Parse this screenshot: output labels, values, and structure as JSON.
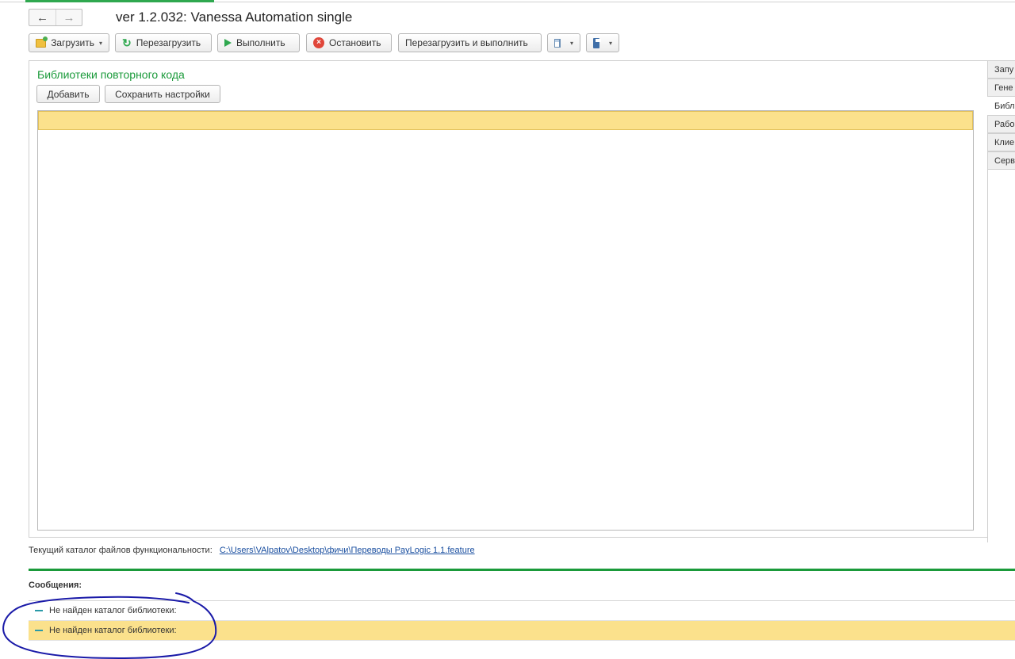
{
  "window": {
    "title": "ver 1.2.032: Vanessa Automation single",
    "back_glyph": "←",
    "forward_glyph": "→"
  },
  "toolbar": {
    "load_label": "Загрузить",
    "reload_label": "Перезагрузить",
    "run_label": "Выполнить",
    "stop_label": "Остановить",
    "reload_run_label": "Перезагрузить и выполнить",
    "dropdown_glyph": "▾"
  },
  "library_section": {
    "title": "Библиотеки повторного кода",
    "add_label": "Добавить",
    "save_settings_label": "Сохранить настройки"
  },
  "side_tabs": [
    "Запу",
    "Гене",
    "Библ",
    "Рабо",
    "Клие",
    "Серв"
  ],
  "active_side_tab": 2,
  "path_info": {
    "label": "Текущий каталог файлов функциональности:",
    "path": "C:\\Users\\VAlpatov\\Desktop\\фичи\\Переводы PayLogic 1.1.feature"
  },
  "messages": {
    "title": "Сообщения:",
    "items": [
      "Не найден каталог библиотеки:",
      "Не найден каталог библиотеки:"
    ]
  },
  "colors": {
    "accent_green": "#1a9a3a",
    "selection_yellow": "#fbe18c",
    "annotation_blue": "#1a1aa8"
  }
}
